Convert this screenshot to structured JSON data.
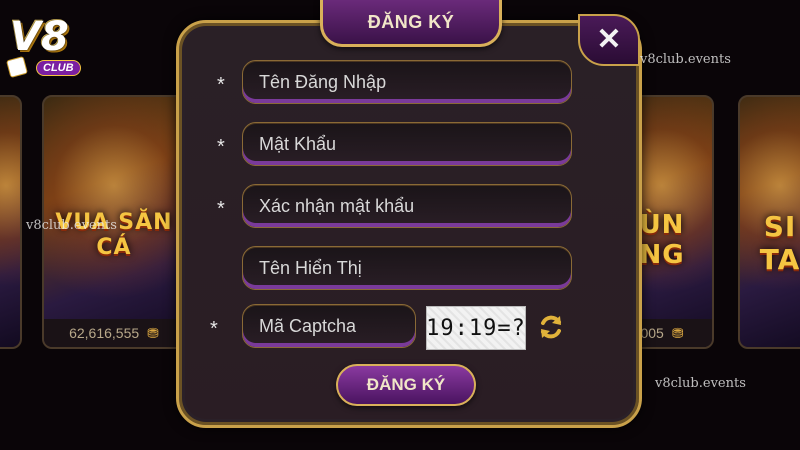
{
  "colors": {
    "accent_gold": "#c9a14a",
    "accent_purple": "#7a3a9a",
    "panel": "#2a2026"
  },
  "watermark": "v8club.events",
  "logo": {
    "text": "V8",
    "sub": "CLUB"
  },
  "background_cards": [
    {
      "title": "",
      "jackpot": ""
    },
    {
      "title": "VUA SĂN CÁ",
      "jackpot": "62,616,555"
    },
    {
      "title": "ÙN NG",
      "jackpot": "005"
    },
    {
      "title": "SI TA",
      "jackpot": ""
    }
  ],
  "dialog": {
    "title": "ĐĂNG KÝ",
    "close_icon": "close-icon",
    "fields": {
      "username": {
        "placeholder": "Tên Đăng Nhập",
        "required_mark": "*"
      },
      "password": {
        "placeholder": "Mật Khẩu",
        "required_mark": "*"
      },
      "confirm_password": {
        "placeholder": "Xác nhận mật khẩu",
        "required_mark": "*"
      },
      "display_name": {
        "placeholder": "Tên Hiển Thị",
        "required_mark": ""
      },
      "captcha": {
        "placeholder": "Mã Captcha",
        "required_mark": "*"
      }
    },
    "captcha_text": "19:19=?",
    "refresh_icon": "refresh-icon",
    "submit_label": "ĐĂNG KÝ"
  }
}
